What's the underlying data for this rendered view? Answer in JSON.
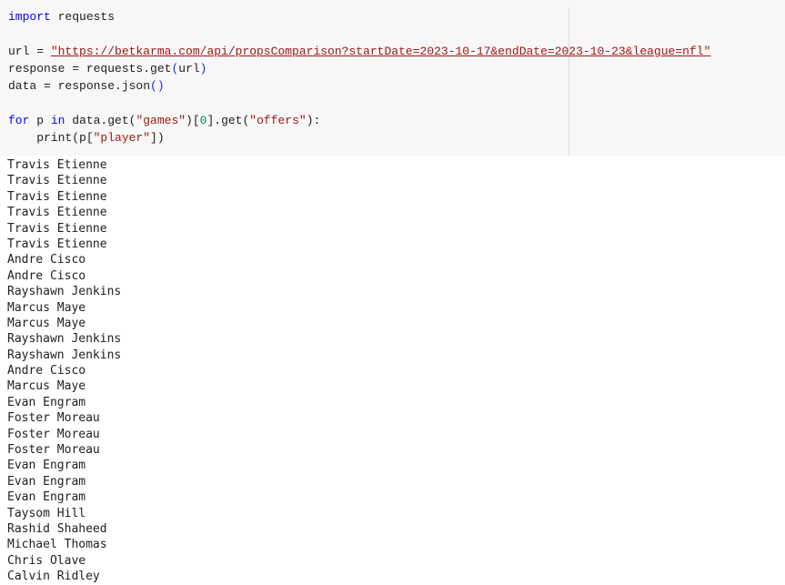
{
  "code": {
    "line1_kw": "import",
    "line1_rest": " requests",
    "line3_pre": "url = ",
    "line3_url": "\"https://betkarma.com/api/propsComparison?startDate=2023-10-17&endDate=2023-10-23&league=nfl\"",
    "line4_pre": "response = requests.get",
    "line4_paren_open": "(",
    "line4_arg": "url",
    "line4_paren_close": ")",
    "line5_pre": "data = response.json",
    "line5_parens": "()",
    "line7_kw1": "for",
    "line7_mid": " p ",
    "line7_kw2": "in",
    "line7_a": " data.get(",
    "line7_str1": "\"games\"",
    "line7_b": ")[",
    "line7_num": "0",
    "line7_c": "].get(",
    "line7_str2": "\"offers\"",
    "line7_d": "):",
    "line8_indent": "    print(p[",
    "line8_str": "\"player\"",
    "line8_end": "])"
  },
  "output": {
    "lines": [
      "Travis Etienne",
      "Travis Etienne",
      "Travis Etienne",
      "Travis Etienne",
      "Travis Etienne",
      "Travis Etienne",
      "Andre Cisco",
      "Andre Cisco",
      "Rayshawn Jenkins",
      "Marcus Maye",
      "Marcus Maye",
      "Rayshawn Jenkins",
      "Rayshawn Jenkins",
      "Andre Cisco",
      "Marcus Maye",
      "Evan Engram",
      "Foster Moreau",
      "Foster Moreau",
      "Foster Moreau",
      "Evan Engram",
      "Evan Engram",
      "Evan Engram",
      "Taysom Hill",
      "Rashid Shaheed",
      "Michael Thomas",
      "Chris Olave",
      "Calvin Ridley"
    ]
  },
  "colors": {
    "keyword": "#0000ff",
    "string": "#a31515",
    "number": "#098658",
    "cell_background": "#f7f7f7"
  }
}
